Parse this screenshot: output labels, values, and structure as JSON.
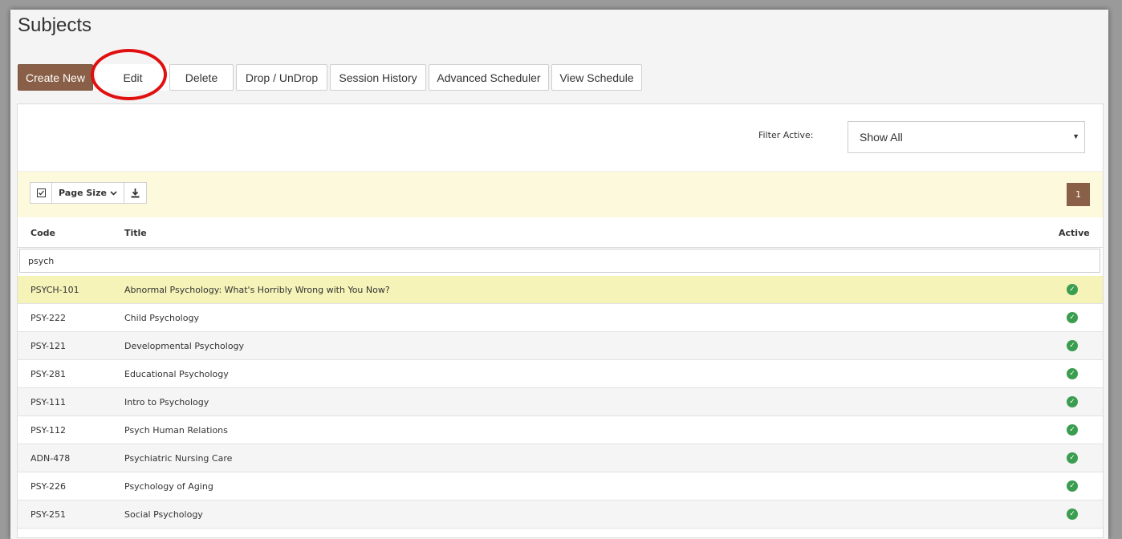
{
  "page": {
    "title": "Subjects"
  },
  "toolbar": {
    "create_label": "Create New",
    "edit_label": "Edit",
    "delete_label": "Delete",
    "drop_label": "Drop / UnDrop",
    "history_label": "Session History",
    "scheduler_label": "Advanced Scheduler",
    "view_schedule_label": "View Schedule"
  },
  "filter": {
    "label": "Filter Active:",
    "selected": "Show All"
  },
  "grid_toolbar": {
    "page_size_label": "Page Size",
    "current_page": "1"
  },
  "columns": {
    "code": "Code",
    "title": "Title",
    "active": "Active"
  },
  "search": {
    "value": "psych"
  },
  "rows": [
    {
      "code": "PSYCH-101",
      "title": "Abnormal Psychology: What's Horribly Wrong with You Now?",
      "active": true
    },
    {
      "code": "PSY-222",
      "title": "Child Psychology",
      "active": true
    },
    {
      "code": "PSY-121",
      "title": "Developmental Psychology",
      "active": true
    },
    {
      "code": "PSY-281",
      "title": "Educational Psychology",
      "active": true
    },
    {
      "code": "PSY-111",
      "title": "Intro to Psychology",
      "active": true
    },
    {
      "code": "PSY-112",
      "title": "Psych Human Relations",
      "active": true
    },
    {
      "code": "ADN-478",
      "title": "Psychiatric Nursing Care",
      "active": true
    },
    {
      "code": "PSY-226",
      "title": "Psychology of Aging",
      "active": true
    },
    {
      "code": "PSY-251",
      "title": "Social Psychology",
      "active": true
    }
  ],
  "colors": {
    "brand": "#8a5f47",
    "selected_row": "#f5f3b8",
    "active_check": "#3a9d4f",
    "annotation": "#e01010"
  },
  "icons": {
    "select_all": "checkbox-icon",
    "page_size": "chevron-down-icon",
    "export": "download-icon",
    "active": "check-circle-icon",
    "select_caret": "caret-down-icon"
  }
}
